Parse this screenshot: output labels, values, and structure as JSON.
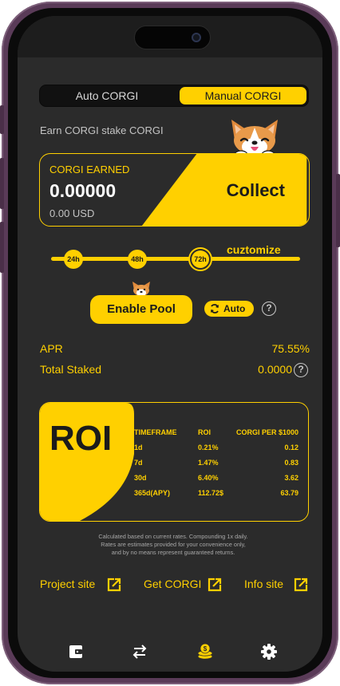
{
  "toggle": {
    "auto_label": "Auto CORGI",
    "manual_label": "Manual CORGI",
    "selected": "Manual CORGI"
  },
  "subtitle": "Earn CORGI stake CORGI",
  "earned": {
    "label": "CORGI EARNED",
    "value": "0.00000",
    "usd": "0.00 USD",
    "collect_label": "Collect"
  },
  "timeframes": {
    "options": [
      "24h",
      "48h",
      "72h"
    ],
    "selected": "72h",
    "customize_label": "cuztomize"
  },
  "pool": {
    "enable_label": "Enable Pool",
    "auto_label": "Auto"
  },
  "stats": {
    "apr_label": "APR",
    "apr_value": "75.55%",
    "staked_label": "Total Staked",
    "staked_value": "0.0000"
  },
  "roi": {
    "title": "ROI",
    "headers": [
      "TIMEFRAME",
      "ROI",
      "CORGI PER $1000"
    ],
    "rows": [
      [
        "1d",
        "0.21%",
        "0.12"
      ],
      [
        "7d",
        "1.47%",
        "0.83"
      ],
      [
        "30d",
        "6.40%",
        "3.62"
      ],
      [
        "365d(APY)",
        "112.72$",
        "63.79"
      ]
    ]
  },
  "disclaimer": {
    "line1": "Calculated based on current rates. Compounding 1x daily.",
    "line2": "Rates are estimates provided for your convenience only,",
    "line3": "and by no means represent guaranteed returns."
  },
  "links": {
    "project": "Project site",
    "get": "Get CORGI",
    "info": "Info site"
  },
  "tabbar": {
    "items": [
      "wallet-icon",
      "swap-icon",
      "coins-icon",
      "gear-icon"
    ],
    "active": "coins-icon"
  },
  "colors": {
    "accent": "#ffd000",
    "background": "#2b2b2b",
    "frame": "#5a3b58"
  }
}
